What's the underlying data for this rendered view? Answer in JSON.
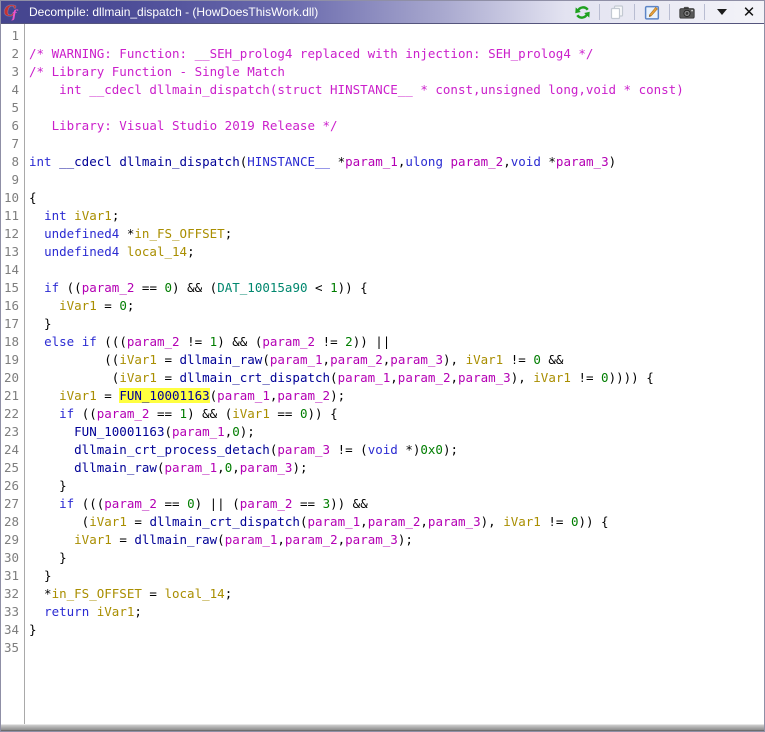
{
  "window": {
    "title": "Decompile: dllmain_dispatch - (HowDoesThisWork.dll)",
    "app_icon": "decompiler-cf-icon",
    "titlebar_gradient": [
      "#45458e",
      "#f3f3f8"
    ],
    "title_text_color": "#ffffff"
  },
  "toolbar": {
    "buttons": [
      {
        "name": "re-decompile-button",
        "icon": "refresh-icon",
        "enabled": true
      },
      {
        "name": "copy-button",
        "icon": "copy-icon",
        "enabled": false
      },
      {
        "name": "edit-button",
        "icon": "edit-pencil-icon",
        "enabled": true
      },
      {
        "name": "snapshot-button",
        "icon": "camera-icon",
        "enabled": true
      },
      {
        "name": "menu-button",
        "icon": "chevron-down-icon",
        "enabled": true
      },
      {
        "name": "close-button",
        "icon": "close-icon",
        "enabled": true
      }
    ]
  },
  "syntax_colors": {
    "p": "#000000",
    "k": "#2b2bd2",
    "f": "#000096",
    "m": "#b400b4",
    "v": "#a98e00",
    "n": "#007d00",
    "g": "#00876e",
    "c": "#cb1fcb",
    "h": "#000096",
    "highlight_bg": "#ffff40",
    "line_number": "#7e7e7e"
  },
  "editor": {
    "line_count": 35,
    "highlighted_token": "FUN_10001163",
    "lines": [
      {
        "n": 1,
        "s": []
      },
      {
        "n": 2,
        "s": [
          [
            "c",
            "/* WARNING: Function: __SEH_prolog4 replaced with injection: SEH_prolog4 */"
          ]
        ]
      },
      {
        "n": 3,
        "s": [
          [
            "c",
            "/* Library Function - Single Match"
          ]
        ]
      },
      {
        "n": 4,
        "s": [
          [
            "c",
            "    int __cdecl dllmain_dispatch(struct HINSTANCE__ * const,unsigned long,void * const)"
          ]
        ]
      },
      {
        "n": 5,
        "s": []
      },
      {
        "n": 6,
        "s": [
          [
            "c",
            "   Library: Visual Studio 2019 Release */"
          ]
        ]
      },
      {
        "n": 7,
        "s": []
      },
      {
        "n": 8,
        "s": [
          [
            "k",
            "int"
          ],
          [
            "p",
            " "
          ],
          [
            "f",
            "__cdecl"
          ],
          [
            "p",
            " "
          ],
          [
            "f",
            "dllmain_dispatch"
          ],
          [
            "p",
            "("
          ],
          [
            "k",
            "HINSTANCE__"
          ],
          [
            "p",
            " *"
          ],
          [
            "m",
            "param_1"
          ],
          [
            "p",
            ","
          ],
          [
            "k",
            "ulong"
          ],
          [
            "p",
            " "
          ],
          [
            "m",
            "param_2"
          ],
          [
            "p",
            ","
          ],
          [
            "k",
            "void"
          ],
          [
            "p",
            " *"
          ],
          [
            "m",
            "param_3"
          ],
          [
            "p",
            ")"
          ]
        ]
      },
      {
        "n": 9,
        "s": []
      },
      {
        "n": 10,
        "s": [
          [
            "p",
            "{"
          ]
        ]
      },
      {
        "n": 11,
        "s": [
          [
            "p",
            "  "
          ],
          [
            "k",
            "int"
          ],
          [
            "p",
            " "
          ],
          [
            "v",
            "iVar1"
          ],
          [
            "p",
            ";"
          ]
        ]
      },
      {
        "n": 12,
        "s": [
          [
            "p",
            "  "
          ],
          [
            "k",
            "undefined4"
          ],
          [
            "p",
            " *"
          ],
          [
            "v",
            "in_FS_OFFSET"
          ],
          [
            "p",
            ";"
          ]
        ]
      },
      {
        "n": 13,
        "s": [
          [
            "p",
            "  "
          ],
          [
            "k",
            "undefined4"
          ],
          [
            "p",
            " "
          ],
          [
            "v",
            "local_14"
          ],
          [
            "p",
            ";"
          ]
        ]
      },
      {
        "n": 14,
        "s": []
      },
      {
        "n": 15,
        "s": [
          [
            "p",
            "  "
          ],
          [
            "k",
            "if"
          ],
          [
            "p",
            " (("
          ],
          [
            "m",
            "param_2"
          ],
          [
            "p",
            " == "
          ],
          [
            "n",
            "0"
          ],
          [
            "p",
            ") && ("
          ],
          [
            "g",
            "DAT_10015a90"
          ],
          [
            "p",
            " < "
          ],
          [
            "n",
            "1"
          ],
          [
            "p",
            ")) {"
          ]
        ]
      },
      {
        "n": 16,
        "s": [
          [
            "p",
            "    "
          ],
          [
            "v",
            "iVar1"
          ],
          [
            "p",
            " = "
          ],
          [
            "n",
            "0"
          ],
          [
            "p",
            ";"
          ]
        ]
      },
      {
        "n": 17,
        "s": [
          [
            "p",
            "  }"
          ]
        ]
      },
      {
        "n": 18,
        "s": [
          [
            "p",
            "  "
          ],
          [
            "k",
            "else"
          ],
          [
            "p",
            " "
          ],
          [
            "k",
            "if"
          ],
          [
            "p",
            " ((("
          ],
          [
            "m",
            "param_2"
          ],
          [
            "p",
            " != "
          ],
          [
            "n",
            "1"
          ],
          [
            "p",
            ") && ("
          ],
          [
            "m",
            "param_2"
          ],
          [
            "p",
            " != "
          ],
          [
            "n",
            "2"
          ],
          [
            "p",
            ")) ||"
          ]
        ]
      },
      {
        "n": 19,
        "s": [
          [
            "p",
            "          (("
          ],
          [
            "v",
            "iVar1"
          ],
          [
            "p",
            " = "
          ],
          [
            "f",
            "dllmain_raw"
          ],
          [
            "p",
            "("
          ],
          [
            "m",
            "param_1"
          ],
          [
            "p",
            ","
          ],
          [
            "m",
            "param_2"
          ],
          [
            "p",
            ","
          ],
          [
            "m",
            "param_3"
          ],
          [
            "p",
            "), "
          ],
          [
            "v",
            "iVar1"
          ],
          [
            "p",
            " != "
          ],
          [
            "n",
            "0"
          ],
          [
            "p",
            " &&"
          ]
        ]
      },
      {
        "n": 20,
        "s": [
          [
            "p",
            "           ("
          ],
          [
            "v",
            "iVar1"
          ],
          [
            "p",
            " = "
          ],
          [
            "f",
            "dllmain_crt_dispatch"
          ],
          [
            "p",
            "("
          ],
          [
            "m",
            "param_1"
          ],
          [
            "p",
            ","
          ],
          [
            "m",
            "param_2"
          ],
          [
            "p",
            ","
          ],
          [
            "m",
            "param_3"
          ],
          [
            "p",
            "), "
          ],
          [
            "v",
            "iVar1"
          ],
          [
            "p",
            " != "
          ],
          [
            "n",
            "0"
          ],
          [
            "p",
            ")))) {"
          ]
        ]
      },
      {
        "n": 21,
        "s": [
          [
            "p",
            "    "
          ],
          [
            "v",
            "iVar1"
          ],
          [
            "p",
            " = "
          ],
          [
            "h",
            "FUN_10001163"
          ],
          [
            "p",
            "("
          ],
          [
            "m",
            "param_1"
          ],
          [
            "p",
            ","
          ],
          [
            "m",
            "param_2"
          ],
          [
            "p",
            ");"
          ]
        ]
      },
      {
        "n": 22,
        "s": [
          [
            "p",
            "    "
          ],
          [
            "k",
            "if"
          ],
          [
            "p",
            " (("
          ],
          [
            "m",
            "param_2"
          ],
          [
            "p",
            " == "
          ],
          [
            "n",
            "1"
          ],
          [
            "p",
            ") && ("
          ],
          [
            "v",
            "iVar1"
          ],
          [
            "p",
            " == "
          ],
          [
            "n",
            "0"
          ],
          [
            "p",
            ")) {"
          ]
        ]
      },
      {
        "n": 23,
        "s": [
          [
            "p",
            "      "
          ],
          [
            "f",
            "FUN_10001163"
          ],
          [
            "p",
            "("
          ],
          [
            "m",
            "param_1"
          ],
          [
            "p",
            ","
          ],
          [
            "n",
            "0"
          ],
          [
            "p",
            ");"
          ]
        ]
      },
      {
        "n": 24,
        "s": [
          [
            "p",
            "      "
          ],
          [
            "f",
            "dllmain_crt_process_detach"
          ],
          [
            "p",
            "("
          ],
          [
            "m",
            "param_3"
          ],
          [
            "p",
            " != ("
          ],
          [
            "k",
            "void"
          ],
          [
            "p",
            " *)"
          ],
          [
            "n",
            "0x0"
          ],
          [
            "p",
            ");"
          ]
        ]
      },
      {
        "n": 25,
        "s": [
          [
            "p",
            "      "
          ],
          [
            "f",
            "dllmain_raw"
          ],
          [
            "p",
            "("
          ],
          [
            "m",
            "param_1"
          ],
          [
            "p",
            ","
          ],
          [
            "n",
            "0"
          ],
          [
            "p",
            ","
          ],
          [
            "m",
            "param_3"
          ],
          [
            "p",
            ");"
          ]
        ]
      },
      {
        "n": 26,
        "s": [
          [
            "p",
            "    }"
          ]
        ]
      },
      {
        "n": 27,
        "s": [
          [
            "p",
            "    "
          ],
          [
            "k",
            "if"
          ],
          [
            "p",
            " ((("
          ],
          [
            "m",
            "param_2"
          ],
          [
            "p",
            " == "
          ],
          [
            "n",
            "0"
          ],
          [
            "p",
            ") || ("
          ],
          [
            "m",
            "param_2"
          ],
          [
            "p",
            " == "
          ],
          [
            "n",
            "3"
          ],
          [
            "p",
            ")) &&"
          ]
        ]
      },
      {
        "n": 28,
        "s": [
          [
            "p",
            "       ("
          ],
          [
            "v",
            "iVar1"
          ],
          [
            "p",
            " = "
          ],
          [
            "f",
            "dllmain_crt_dispatch"
          ],
          [
            "p",
            "("
          ],
          [
            "m",
            "param_1"
          ],
          [
            "p",
            ","
          ],
          [
            "m",
            "param_2"
          ],
          [
            "p",
            ","
          ],
          [
            "m",
            "param_3"
          ],
          [
            "p",
            "), "
          ],
          [
            "v",
            "iVar1"
          ],
          [
            "p",
            " != "
          ],
          [
            "n",
            "0"
          ],
          [
            "p",
            ")) {"
          ]
        ]
      },
      {
        "n": 29,
        "s": [
          [
            "p",
            "      "
          ],
          [
            "v",
            "iVar1"
          ],
          [
            "p",
            " = "
          ],
          [
            "f",
            "dllmain_raw"
          ],
          [
            "p",
            "("
          ],
          [
            "m",
            "param_1"
          ],
          [
            "p",
            ","
          ],
          [
            "m",
            "param_2"
          ],
          [
            "p",
            ","
          ],
          [
            "m",
            "param_3"
          ],
          [
            "p",
            ");"
          ]
        ]
      },
      {
        "n": 30,
        "s": [
          [
            "p",
            "    }"
          ]
        ]
      },
      {
        "n": 31,
        "s": [
          [
            "p",
            "  }"
          ]
        ]
      },
      {
        "n": 32,
        "s": [
          [
            "p",
            "  *"
          ],
          [
            "v",
            "in_FS_OFFSET"
          ],
          [
            "p",
            " = "
          ],
          [
            "v",
            "local_14"
          ],
          [
            "p",
            ";"
          ]
        ]
      },
      {
        "n": 33,
        "s": [
          [
            "p",
            "  "
          ],
          [
            "k",
            "return"
          ],
          [
            "p",
            " "
          ],
          [
            "v",
            "iVar1"
          ],
          [
            "p",
            ";"
          ]
        ]
      },
      {
        "n": 34,
        "s": [
          [
            "p",
            "}"
          ]
        ]
      },
      {
        "n": 35,
        "s": []
      }
    ]
  }
}
